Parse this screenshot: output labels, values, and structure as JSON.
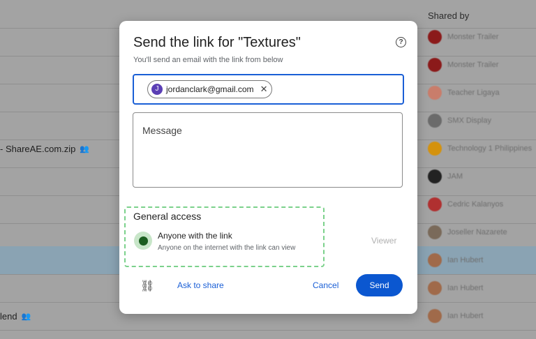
{
  "background": {
    "shared_by_header": "Shared by",
    "files": [
      {
        "name": "- ShareAE.com.zip",
        "icon": "people-icon"
      },
      {
        "name": "lend",
        "icon": "people-icon"
      }
    ],
    "sharers": [
      {
        "name": "Monster Trailer",
        "color": "#8b1a1a"
      },
      {
        "name": "Monster Trailer",
        "color": "#8b1a1a"
      },
      {
        "name": "Teacher Ligaya",
        "color": "#c97d6b"
      },
      {
        "name": "SMX Display",
        "color": "#6b6b6b"
      },
      {
        "name": "Technology 1 Philippines",
        "color": "#d4920d"
      },
      {
        "name": "JAM",
        "color": "#222222"
      },
      {
        "name": "Cedric Kalanyos",
        "color": "#b03030"
      },
      {
        "name": "Joseller Nazarete",
        "color": "#7a6a5a"
      },
      {
        "name": "Ian Hubert",
        "color": "#a06a4a"
      },
      {
        "name": "Ian Hubert",
        "color": "#a06a4a"
      },
      {
        "name": "Ian Hubert",
        "color": "#a06a4a"
      }
    ]
  },
  "dialog": {
    "title": "Send the link for \"Textures\"",
    "help_icon": "help-circle-icon",
    "subtitle": "You'll send an email with the link from below",
    "recipient": {
      "initial": "J",
      "email": "jordanclark@gmail.com"
    },
    "message_placeholder": "Message",
    "general_access": {
      "heading": "General access",
      "icon": "globe-icon",
      "name": "Anyone with the link",
      "description": "Anyone on the internet with the link can view",
      "role": "Viewer"
    },
    "footer": {
      "link_icon": "link-icon",
      "ask_label": "Ask to share",
      "cancel_label": "Cancel",
      "send_label": "Send"
    }
  }
}
